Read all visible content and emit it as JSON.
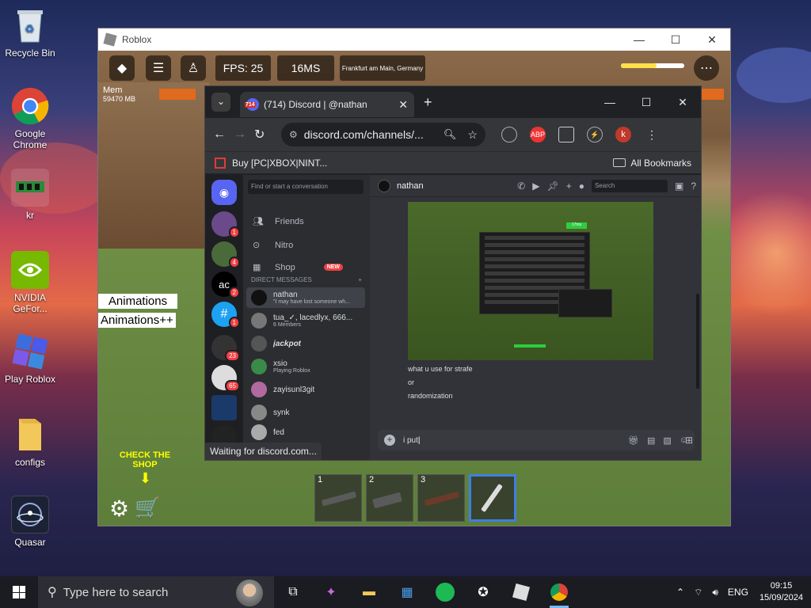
{
  "desktop": {
    "icons": [
      {
        "label": "Recycle Bin"
      },
      {
        "label": "Google Chrome"
      },
      {
        "label": "kr"
      },
      {
        "label": "NVIDIA GeFor..."
      },
      {
        "label": "Play Roblox"
      },
      {
        "label": "configs"
      },
      {
        "label": "Quasar"
      }
    ]
  },
  "roblox": {
    "title": "Roblox",
    "fps": "FPS: 25",
    "ping": "16MS",
    "location": "Frankfurt am Main, Germany",
    "mem_label": "Mem",
    "mem_value": "59470 MB",
    "animations": "Animations",
    "animations_plus": "Animations++",
    "check_shop": "CHECK THE SHOP",
    "hotbar": [
      {
        "num": "1"
      },
      {
        "num": "2"
      },
      {
        "num": "3"
      },
      {
        "num": ""
      }
    ]
  },
  "chrome": {
    "tab_title": "(714) Discord | @nathan",
    "tab_badge": "714",
    "url": "discord.com/channels/...",
    "bookmark": "Buy [PC|XBOX|NINT...",
    "all_bookmarks": "All Bookmarks",
    "profile_initial": "k",
    "status": "Waiting for discord.com..."
  },
  "discord": {
    "servers": [
      {
        "badge": "1",
        "color": "#6a4a8a"
      },
      {
        "badge": "4",
        "color": "#4a6a3a"
      },
      {
        "badge": "2",
        "color": "#000000"
      },
      {
        "badge": "1",
        "color": "#1da1f2"
      },
      {
        "badge": "23",
        "color": "#333333"
      },
      {
        "badge": "65",
        "color": "#dddddd"
      },
      {
        "badge": "",
        "color": "#1a3a6a"
      },
      {
        "badge": "",
        "color": "#222222"
      }
    ],
    "search_placeholder": "Find or start a conversation",
    "nav": {
      "friends": "Friends",
      "nitro": "Nitro",
      "shop": "Shop",
      "shop_badge": "NEW"
    },
    "dm_header": "DIRECT MESSAGES",
    "dms": [
      {
        "name": "nathan",
        "status": "\"I may have lost someone wh...",
        "color": "#111111"
      },
      {
        "name": "tua_✓, lacedlyx, 666...",
        "status": "6 Members",
        "color": "#777777"
      },
      {
        "name": "jackpot",
        "status": "",
        "color": "#555555"
      },
      {
        "name": "xsio",
        "status": "Playing Roblox",
        "color": "#3a8a4a"
      },
      {
        "name": "zayisunl3git",
        "status": "",
        "color": "#b06aa0"
      },
      {
        "name": "synk",
        "status": "",
        "color": "#888888"
      },
      {
        "name": "fed",
        "status": "",
        "color": "#aaaaaa"
      }
    ],
    "chat": {
      "recipient": "nathan",
      "search_placeholder": "Search",
      "ms_badge": "17ms",
      "messages": [
        "what u use for strafe",
        "or",
        "randomization"
      ],
      "input_value": "i put"
    }
  },
  "taskbar": {
    "search_placeholder": "Type here to search",
    "language": "ENG",
    "time": "09:15",
    "date": "15/09/2024"
  }
}
